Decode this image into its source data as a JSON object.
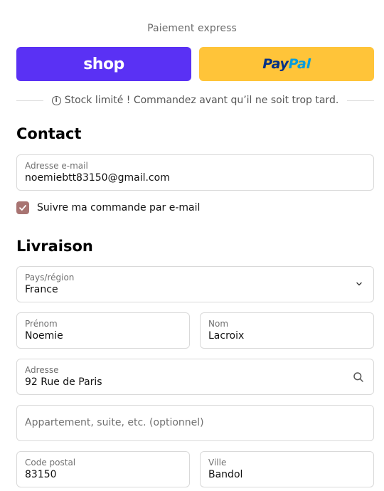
{
  "express": {
    "title": "Paiement express",
    "shop_label": "shop",
    "paypal_label_a": "Pay",
    "paypal_label_b": "Pal"
  },
  "notice": {
    "icon": "info-icon",
    "text": "Stock limité ! Commandez avant qu’il ne soit trop tard."
  },
  "contact": {
    "title": "Contact",
    "email_label": "Adresse e-mail",
    "email_value": "noemiebtt83150@gmail.com",
    "track_label": "Suivre ma commande par e-mail",
    "track_checked": true
  },
  "delivery": {
    "title": "Livraison",
    "country_label": "Pays/région",
    "country_value": "France",
    "first_name_label": "Prénom",
    "first_name_value": "Noemie",
    "last_name_label": "Nom",
    "last_name_value": "Lacroix",
    "address_label": "Adresse",
    "address_value": "92 Rue de Paris",
    "apartment_placeholder": "Appartement, suite, etc. (optionnel)",
    "postal_label": "Code postal",
    "postal_value": "83150",
    "city_label": "Ville",
    "city_value": "Bandol"
  },
  "colors": {
    "shop_brand": "#5a31f4",
    "paypal_brand": "#ffc439",
    "checkbox_accent": "#a87472"
  }
}
